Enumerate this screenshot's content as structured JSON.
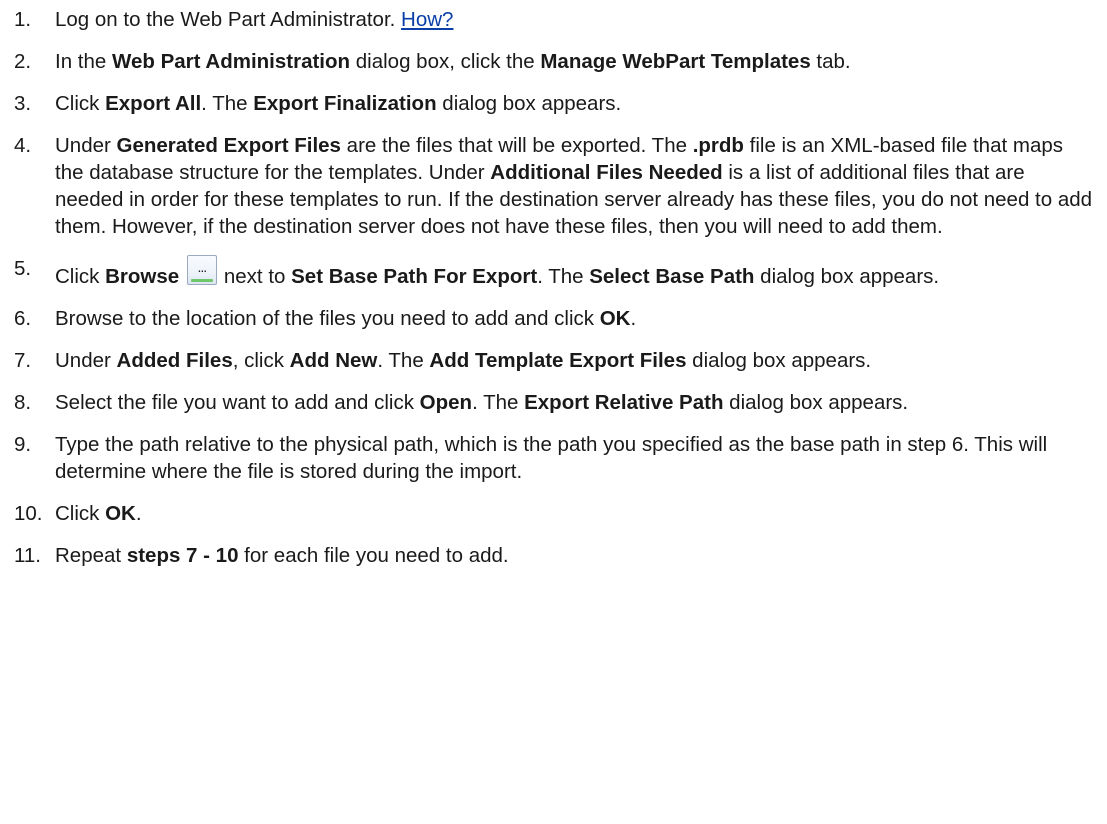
{
  "steps": [
    {
      "number": "1.",
      "parts": [
        {
          "t": "Log on to the Web Part Administrator. "
        },
        {
          "t": "How?",
          "link": true
        }
      ]
    },
    {
      "number": "2.",
      "parts": [
        {
          "t": "In the "
        },
        {
          "t": "Web Part Administration",
          "b": true
        },
        {
          "t": " dialog box, click the "
        },
        {
          "t": "Manage WebPart Templates",
          "b": true
        },
        {
          "t": " tab."
        }
      ]
    },
    {
      "number": "3.",
      "parts": [
        {
          "t": "Click "
        },
        {
          "t": "Export All",
          "b": true
        },
        {
          "t": ". The "
        },
        {
          "t": "Export Finalization",
          "b": true
        },
        {
          "t": " dialog box appears."
        }
      ]
    },
    {
      "number": "4.",
      "parts": [
        {
          "t": "Under "
        },
        {
          "t": "Generated Export Files",
          "b": true
        },
        {
          "t": " are the files that will be exported. The "
        },
        {
          "t": ".prdb",
          "b": true
        },
        {
          "t": " file is an XML-based file that maps the database structure for the templates. Under "
        },
        {
          "t": "Additional Files Needed",
          "b": true
        },
        {
          "t": " is a list of additional files that are needed in order for these templates to run. If the destination server already has these files, you do not need to add them. However, if the destination server does not have these files, then you will need to add them."
        }
      ]
    },
    {
      "number": "5.",
      "parts": [
        {
          "t": "Click "
        },
        {
          "t": "Browse",
          "b": true
        },
        {
          "t": " "
        },
        {
          "icon": "browse-button-icon",
          "glyph": "..."
        },
        {
          "t": "next to "
        },
        {
          "t": "Set Base Path For Export",
          "b": true
        },
        {
          "t": ". The "
        },
        {
          "t": "Select Base Path",
          "b": true
        },
        {
          "t": " dialog box appears."
        }
      ]
    },
    {
      "number": "6.",
      "parts": [
        {
          "t": "Browse to the location of the files you need to add and click "
        },
        {
          "t": "OK",
          "b": true
        },
        {
          "t": "."
        }
      ]
    },
    {
      "number": "7.",
      "parts": [
        {
          "t": "Under "
        },
        {
          "t": "Added Files",
          "b": true
        },
        {
          "t": ", click "
        },
        {
          "t": "Add New",
          "b": true
        },
        {
          "t": ". The "
        },
        {
          "t": "Add Template Export Files",
          "b": true
        },
        {
          "t": " dialog box appears."
        }
      ]
    },
    {
      "number": "8.",
      "parts": [
        {
          "t": "Select the file you want to add and click "
        },
        {
          "t": "Open",
          "b": true
        },
        {
          "t": ". The "
        },
        {
          "t": "Export Relative Path",
          "b": true
        },
        {
          "t": " dialog box appears."
        }
      ]
    },
    {
      "number": "9.",
      "parts": [
        {
          "t": "Type the path relative to the physical path, which is the path you specified as the base path in step 6. This will determine where the file is stored during the import."
        }
      ]
    },
    {
      "number": "10.",
      "parts": [
        {
          "t": "Click "
        },
        {
          "t": "OK",
          "b": true
        },
        {
          "t": "."
        }
      ]
    },
    {
      "number": "11.",
      "parts": [
        {
          "t": "Repeat "
        },
        {
          "t": "steps 7 - 10",
          "b": true
        },
        {
          "t": " for each file you need to add."
        }
      ]
    }
  ]
}
